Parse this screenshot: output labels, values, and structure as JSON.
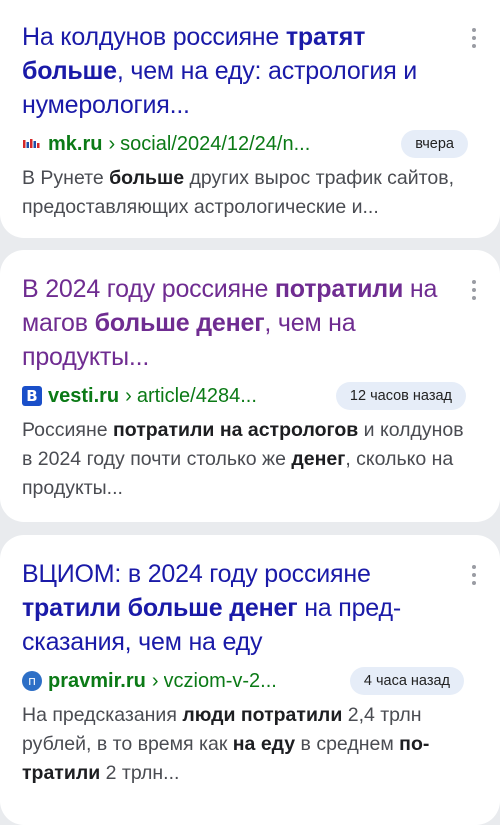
{
  "results": [
    {
      "title_parts": [
        {
          "text": "На колдунов россияне ",
          "bold": false
        },
        {
          "text": "тратят больше",
          "bold": true
        },
        {
          "text": ", чем на еду: астрология и нумерология...",
          "bold": false
        }
      ],
      "visited": false,
      "favicon": "mk-logo-icon",
      "domain": "mk.ru",
      "separator": "›",
      "path": "social/2024/12/24/n...",
      "date_badge": "вчера",
      "snippet_parts": [
        {
          "text": "В Рунете ",
          "bold": false
        },
        {
          "text": "больше",
          "bold": true
        },
        {
          "text": " других вырос трафик сай­тов, предоставляющих астрологические и...",
          "bold": false
        }
      ]
    },
    {
      "title_parts": [
        {
          "text": "В 2024 году россияне ",
          "bold": false
        },
        {
          "text": "потратили",
          "bold": true
        },
        {
          "text": " на магов ",
          "bold": false
        },
        {
          "text": "больше денег",
          "bold": true
        },
        {
          "text": ", чем на продукты...",
          "bold": false
        }
      ],
      "visited": true,
      "favicon": "vesti-logo-icon",
      "favicon_letter": "B",
      "domain": "vesti.ru",
      "separator": "›",
      "path": "article/4284...",
      "date_badge": "12 часов назад",
      "snippet_parts": [
        {
          "text": "Россияне ",
          "bold": false
        },
        {
          "text": "потратили на астрологов",
          "bold": true
        },
        {
          "text": " и колду­нов в 2024 году почти столько же ",
          "bold": false
        },
        {
          "text": "денег",
          "bold": true
        },
        {
          "text": ", сколько на продукты...",
          "bold": false
        }
      ]
    },
    {
      "title_parts": [
        {
          "text": "ВЦИОМ: в 2024 году россияне ",
          "bold": false
        },
        {
          "text": "тратили больше денег",
          "bold": true
        },
        {
          "text": " на пред­сказания, чем на еду",
          "bold": false
        }
      ],
      "visited": false,
      "favicon": "pravmir-logo-icon",
      "favicon_letter": "п",
      "domain": "pravmir.ru",
      "separator": "›",
      "path": "vcziom-v-2...",
      "date_badge": "4 часа назад",
      "snippet_parts": [
        {
          "text": "На предсказания ",
          "bold": false
        },
        {
          "text": "люди потратили",
          "bold": true
        },
        {
          "text": " 2,4 трлн рублей, в то время как ",
          "bold": false
        },
        {
          "text": "на еду",
          "bold": true
        },
        {
          "text": " в среднем ",
          "bold": false
        },
        {
          "text": "по­тратили",
          "bold": true
        },
        {
          "text": " 2 трлн...",
          "bold": false
        }
      ]
    }
  ],
  "colors": {
    "page_bg": "#e9ebee",
    "card_bg": "#ffffff",
    "title_link": "#1a1aa8",
    "title_visited": "#6f2c91",
    "url_green": "#0b7a16",
    "badge_bg": "#e6edf8",
    "snippet_text": "#4a4c52",
    "menu_dots": "#9a9ca3"
  }
}
